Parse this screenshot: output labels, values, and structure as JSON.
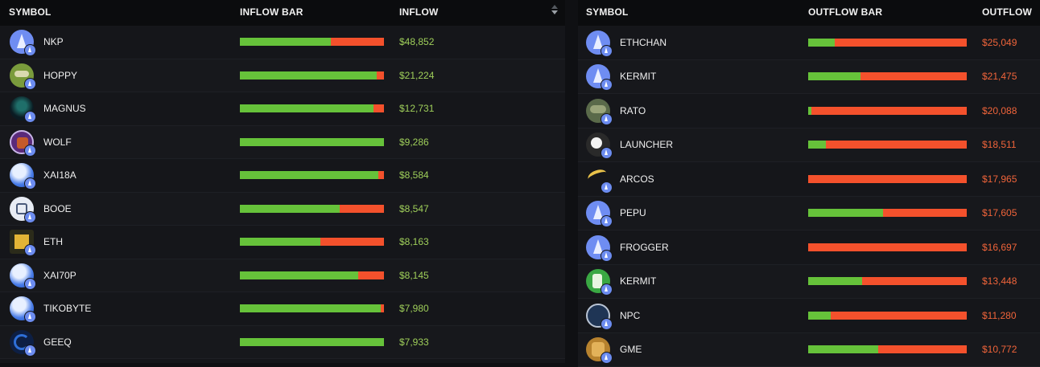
{
  "inflow": {
    "headers": {
      "symbol": "SYMBOL",
      "bar": "INFLOW BAR",
      "value": "INFLOW"
    },
    "rows": [
      {
        "symbol": "NKP",
        "value": "$48,852",
        "green_pct": 63,
        "avatar": "eth"
      },
      {
        "symbol": "HOPPY",
        "value": "$21,224",
        "green_pct": 95,
        "avatar": "frog"
      },
      {
        "symbol": "MAGNUS",
        "value": "$12,731",
        "green_pct": 93,
        "avatar": "dark"
      },
      {
        "symbol": "WOLF",
        "value": "$9,286",
        "green_pct": 100,
        "avatar": "wolf"
      },
      {
        "symbol": "XAI18A",
        "value": "$8,584",
        "green_pct": 96,
        "avatar": "blue"
      },
      {
        "symbol": "BOOE",
        "value": "$8,547",
        "green_pct": 69,
        "avatar": "white"
      },
      {
        "symbol": "ETH",
        "value": "$8,163",
        "green_pct": 56,
        "avatar": "pixel"
      },
      {
        "symbol": "XAI70P",
        "value": "$8,145",
        "green_pct": 82,
        "avatar": "blue"
      },
      {
        "symbol": "TIKOBYTE",
        "value": "$7,980",
        "green_pct": 98,
        "avatar": "blue"
      },
      {
        "symbol": "GEEQ",
        "value": "$7,933",
        "green_pct": 100,
        "avatar": "navy"
      }
    ]
  },
  "outflow": {
    "headers": {
      "symbol": "SYMBOL",
      "bar": "OUTFLOW BAR",
      "value": "OUTFLOW"
    },
    "rows": [
      {
        "symbol": "ETHCHAN",
        "value": "$25,049",
        "green_pct": 17,
        "avatar": "eth"
      },
      {
        "symbol": "KERMIT",
        "value": "$21,475",
        "green_pct": 33,
        "avatar": "eth"
      },
      {
        "symbol": "RATO",
        "value": "$20,088",
        "green_pct": 2,
        "avatar": "rato"
      },
      {
        "symbol": "LAUNCHER",
        "value": "$18,511",
        "green_pct": 11,
        "avatar": "launch"
      },
      {
        "symbol": "ARCOS",
        "value": "$17,965",
        "green_pct": 0,
        "avatar": "arcos"
      },
      {
        "symbol": "PEPU",
        "value": "$17,605",
        "green_pct": 47,
        "avatar": "eth"
      },
      {
        "symbol": "FROGGER",
        "value": "$16,697",
        "green_pct": 0,
        "avatar": "eth"
      },
      {
        "symbol": "KERMIT",
        "value": "$13,448",
        "green_pct": 34,
        "avatar": "green"
      },
      {
        "symbol": "NPC",
        "value": "$11,280",
        "green_pct": 14,
        "avatar": "npc"
      },
      {
        "symbol": "GME",
        "value": "$10,772",
        "green_pct": 44,
        "avatar": "gme"
      }
    ]
  },
  "colors": {
    "inflow_green": "#66c23a",
    "outflow_red": "#f4512c",
    "inflow_value": "#9fcf5a",
    "outflow_value": "#f0643a"
  },
  "icons": {
    "sort": "sort-arrows-icon",
    "chain_badge": "ethereum-icon"
  }
}
